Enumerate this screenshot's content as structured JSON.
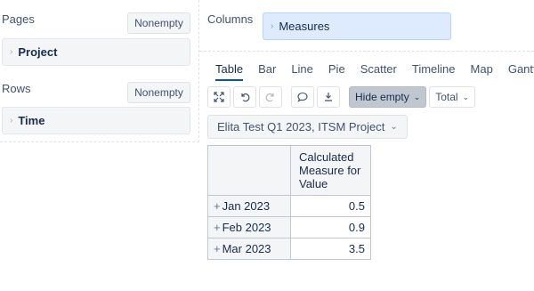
{
  "left": {
    "pages": {
      "label": "Pages",
      "nonempty": "Nonempty",
      "dimension": "Project"
    },
    "rows": {
      "label": "Rows",
      "nonempty": "Nonempty",
      "dimension": "Time"
    }
  },
  "columns": {
    "label": "Columns",
    "dimension": "Measures"
  },
  "tabs": [
    "Table",
    "Bar",
    "Line",
    "Pie",
    "Scatter",
    "Timeline",
    "Map",
    "Gantt"
  ],
  "active_tab": "Table",
  "toolbar": {
    "hide_empty": "Hide empty",
    "total": "Total",
    "icons": [
      "fullscreen-icon",
      "undo-icon",
      "redo-icon",
      "comment-icon",
      "export-icon"
    ]
  },
  "selector": {
    "value": "Elita Test Q1 2023, ITSM Project"
  },
  "table": {
    "column_header": "Calculated Measure for Value",
    "rows": [
      {
        "label": "Jan 2023",
        "value": "0.5"
      },
      {
        "label": "Feb 2023",
        "value": "0.9"
      },
      {
        "label": "Mar 2023",
        "value": "3.5"
      }
    ]
  },
  "colors": {
    "accent": "#0052cc",
    "measures_bg": "#deebff",
    "panel_bg": "#f4f5f7"
  }
}
